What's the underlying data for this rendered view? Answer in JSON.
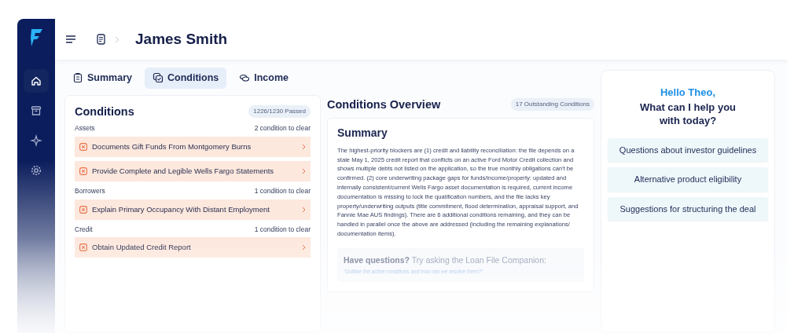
{
  "sidebar": {
    "items": [
      {
        "kind": "home",
        "selected": true
      },
      {
        "kind": "archive",
        "selected": false
      },
      {
        "kind": "sparkle",
        "selected": false
      },
      {
        "kind": "settings",
        "selected": false
      }
    ]
  },
  "header": {
    "title": "James Smith"
  },
  "tabs": [
    {
      "label": "Summary",
      "kind": "clipboard",
      "selected": false
    },
    {
      "label": "Conditions",
      "kind": "copy-check",
      "selected": true
    },
    {
      "label": "Income",
      "kind": "coins",
      "selected": false
    }
  ],
  "conditions": {
    "title": "Conditions",
    "badge": "1226/1230 Passed",
    "groups": [
      {
        "name": "Assets",
        "count": "2 condition to clear",
        "items": [
          "Documents Gift Funds From Montgomery Burns",
          "Provide Complete and Legible Wells Fargo Statements"
        ]
      },
      {
        "name": "Borrowers",
        "count": "1 condition to clear",
        "items": [
          "Explain Primary Occupancy With Distant Employment"
        ]
      },
      {
        "name": "Credit",
        "count": "1 condition to clear",
        "items": [
          "Obtain Updated Credit Report"
        ]
      }
    ]
  },
  "overview": {
    "title": "Conditions Overview",
    "badge": "17 Outstanding Conditions",
    "summary_title": "Summary",
    "summary": "The highest-priority blockers are (1) credit and liability reconciliation: the file depends on a stale May 1, 2025 credit report that conflicts on an active Ford Motor Credit collection and shows multiple debts not listed on the application, so the true monthly obligations can't be confirmed. (2) core underwriting package gaps for funds/income/property: updated and internally consistent/current Wells Fargo asset documentation is required, current income documentation is missing to lock the qualification numbers, and the file lacks key property/underwriting outputs (title commitment, flood determination, appraisal support, and Fannie Mae AUS findings). There are 6 additional conditions remaining, and they can be handled in parallel once the above are addressed (including the remaining explanations/ documentation items).",
    "prompt": "**Have questions?** Try asking the Loan File Companion:",
    "prompt_example": "\"Outline the active conditions and how can we resolve them?\""
  },
  "assistant": {
    "greeting": "Hello Theo,",
    "question": "What can I help you with today?",
    "suggestions": [
      "Questions about investor guidelines",
      "Alternative product eligibility",
      "Suggestions for structuring the deal"
    ]
  }
}
